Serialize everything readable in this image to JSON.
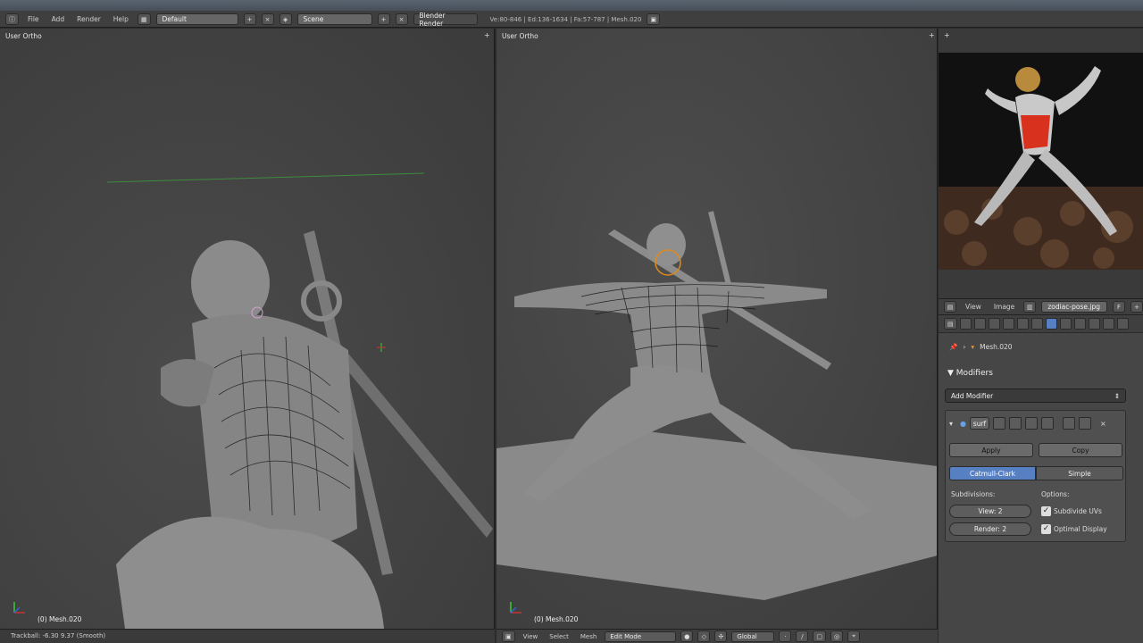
{
  "header": {
    "menus": [
      "File",
      "Add",
      "Render",
      "Help"
    ],
    "layout_name": "Default",
    "scene_name": "Scene",
    "render_engine": "Blender Render",
    "stats": "Ve:80-846 | Ed:136-1634 | Fa:57-787 | Mesh.020"
  },
  "left_viewport": {
    "view_label": "User Ortho",
    "object_label": "(0) Mesh.020",
    "status": "Trackball: -6.30 9.37 (Smooth)"
  },
  "right_viewport": {
    "view_label": "User Ortho",
    "object_label": "(0) Mesh.020",
    "menus": [
      "View",
      "Select",
      "Mesh"
    ],
    "mode": "Edit Mode",
    "orientation": "Global"
  },
  "image_editor": {
    "menus": [
      "View",
      "Image"
    ],
    "image_name": "zodiac-pose.jpg"
  },
  "properties": {
    "breadcrumb": "Mesh.020",
    "section_title": "Modifiers",
    "add_modifier": "Add Modifier",
    "modifier_name": "surf",
    "apply": "Apply",
    "copy": "Copy",
    "catmull_clark": "Catmull-Clark",
    "simple": "Simple",
    "subdivisions_label": "Subdivisions:",
    "options_label": "Options:",
    "view_level": "View: 2",
    "render_level": "Render: 2",
    "subdivide_uvs": "Subdivide UVs",
    "optimal_display": "Optimal Display"
  },
  "colors": {
    "accent": "#5680c2",
    "background": "#3b3b3b"
  }
}
